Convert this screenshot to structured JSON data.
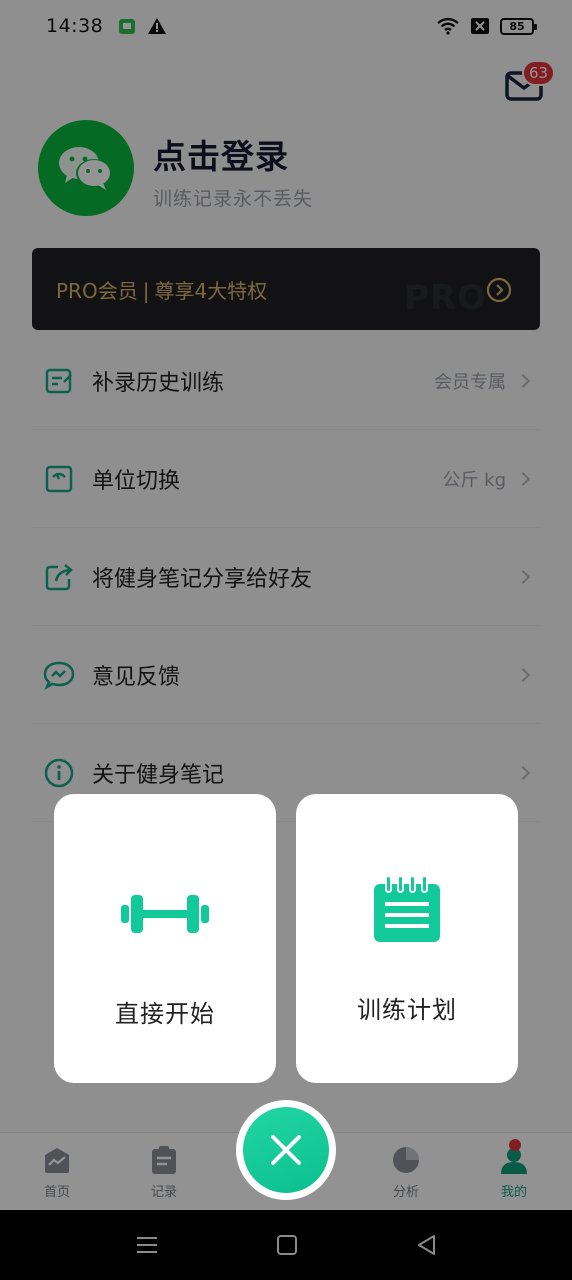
{
  "status_bar": {
    "time": "14:38",
    "battery": "85"
  },
  "mail": {
    "badge": "63"
  },
  "profile": {
    "title": "点击登录",
    "subtitle": "训练记录永不丢失"
  },
  "pro_banner": {
    "label": "PRO会员",
    "separator": "|",
    "benefit": "尊享4大特权",
    "watermark": "PRO"
  },
  "menu": [
    {
      "label": "补录历史训练",
      "value": "会员专属",
      "icon": "edit-note-icon"
    },
    {
      "label": "单位切换",
      "value": "公斤 kg",
      "icon": "scale-icon"
    },
    {
      "label": "将健身笔记分享给好友",
      "value": "",
      "icon": "share-icon"
    },
    {
      "label": "意见反馈",
      "value": "",
      "icon": "feedback-chat-icon"
    },
    {
      "label": "关于健身笔记",
      "value": "",
      "icon": "info-icon"
    }
  ],
  "popup": {
    "start_label": "直接开始",
    "plan_label": "训练计划"
  },
  "tabs": [
    {
      "label": "首页",
      "icon": "home-chart-icon"
    },
    {
      "label": "记录",
      "icon": "clipboard-icon"
    },
    {
      "label": "分析",
      "icon": "pie-chart-icon"
    },
    {
      "label": "我的",
      "icon": "profile-icon"
    }
  ],
  "colors": {
    "accent": "#10c893",
    "pro_gold": "#d7b46a",
    "badge_red": "#e2323e"
  }
}
